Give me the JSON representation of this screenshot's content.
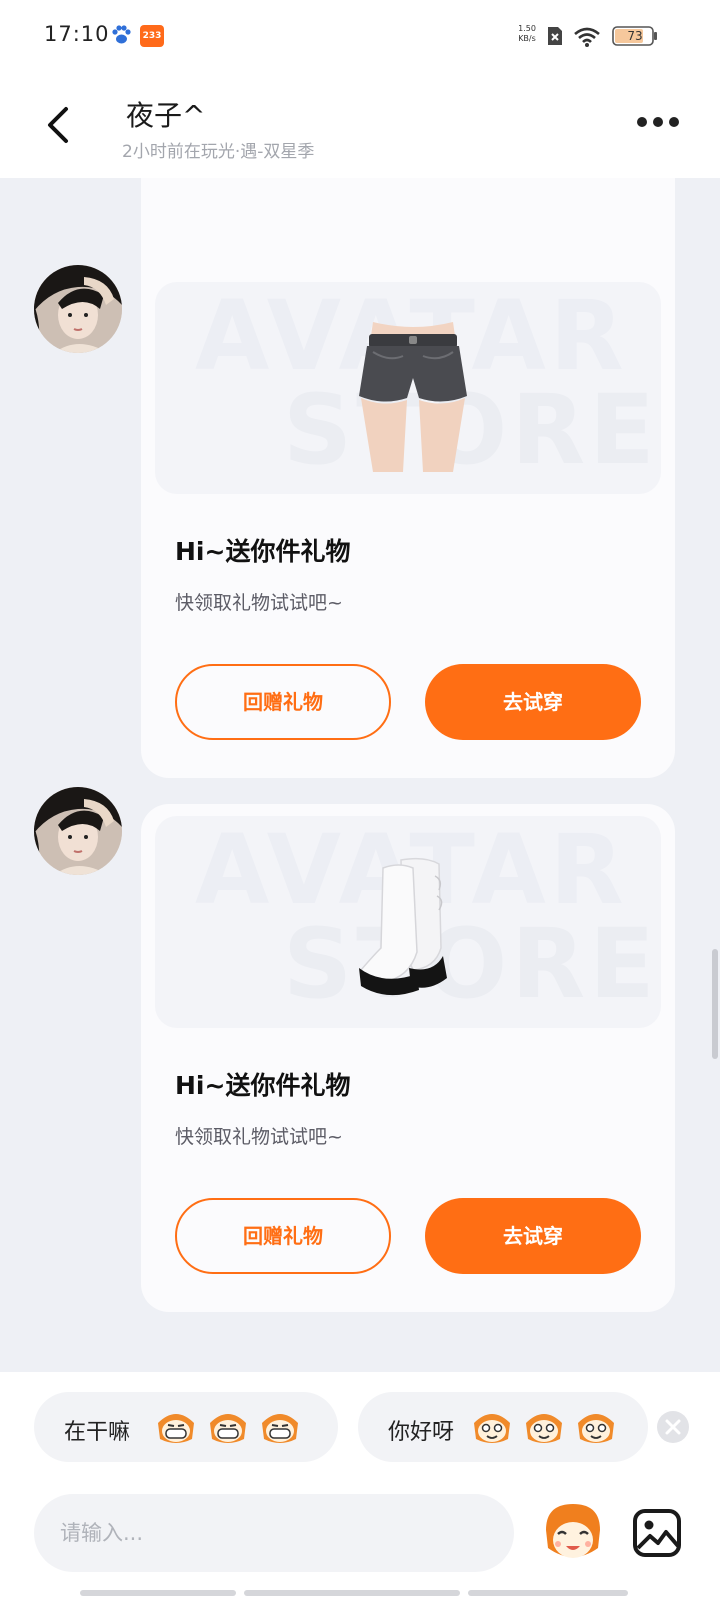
{
  "status_bar": {
    "time": "17:10",
    "game_badge": "233",
    "net_speed_value": "1.50",
    "net_speed_unit": "KB/s",
    "battery": "73"
  },
  "header": {
    "title": "夜子^",
    "subtitle": "2小时前在玩光·遇-双星季"
  },
  "messages": [
    {
      "item": "shorts",
      "watermark_line1": "AVATAR",
      "watermark_line2": "STORE",
      "title": "Hi~送你件礼物",
      "desc": "快领取礼物试试吧~",
      "return_gift_label": "回赠礼物",
      "try_on_label": "去试穿"
    },
    {
      "item": "boots",
      "watermark_line1": "AVATAR",
      "watermark_line2": "STORE",
      "title": "Hi~送你件礼物",
      "desc": "快领取礼物试试吧~",
      "return_gift_label": "回赠礼物",
      "try_on_label": "去试穿"
    }
  ],
  "quick_replies": [
    {
      "text": "在干嘛",
      "emoji": "grinning-monkey-emoji"
    },
    {
      "text": "你好呀",
      "emoji": "smiling-monkey-emoji"
    }
  ],
  "composer": {
    "placeholder": "请输入..."
  },
  "colors": {
    "accent": "#ff6e14",
    "background": "#eef0f5",
    "card": "#fbfbfd"
  }
}
